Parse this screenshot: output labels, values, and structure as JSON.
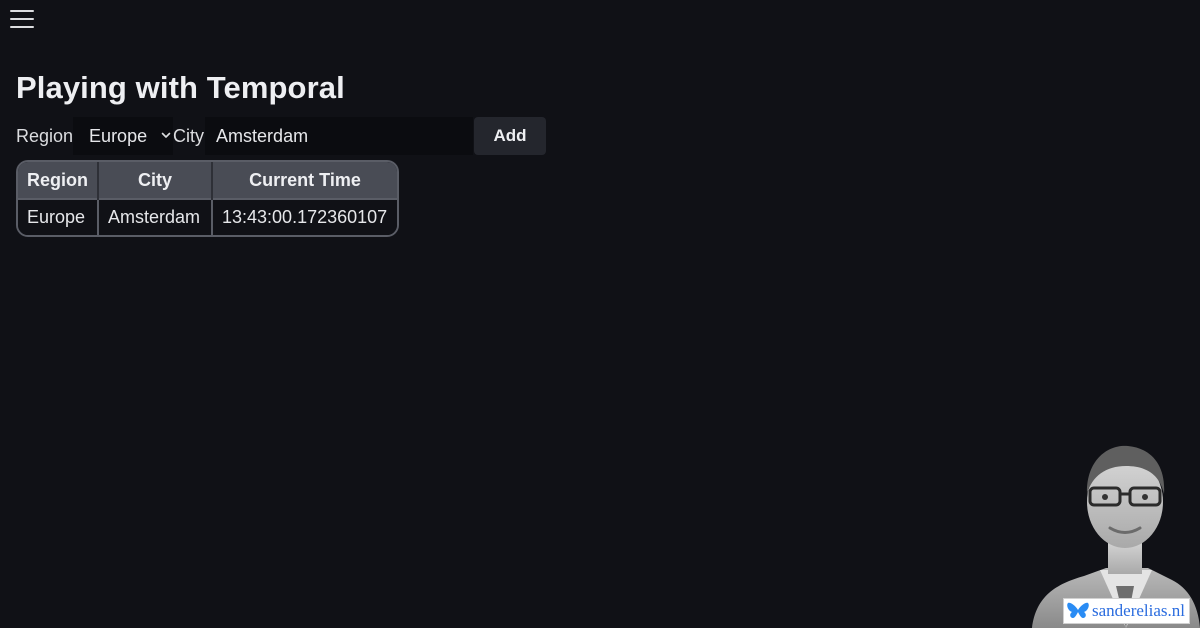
{
  "menu": {
    "icon": "hamburger-menu-icon"
  },
  "page": {
    "title": "Playing with Temporal"
  },
  "form": {
    "region_label": "Region",
    "region_value": "Europe",
    "city_label": "City",
    "city_value": "Amsterdam",
    "add_label": "Add"
  },
  "table": {
    "headers": [
      "Region",
      "City",
      "Current Time"
    ],
    "rows": [
      [
        "Europe",
        "Amsterdam",
        "13:43:00.172360107"
      ]
    ]
  },
  "brand": {
    "text": "sanderelias.nl",
    "icon": "butterfly-icon",
    "color": "#2a6cdf"
  },
  "colors": {
    "background": "#101116",
    "header": "#494c55",
    "button": "#24262d"
  }
}
